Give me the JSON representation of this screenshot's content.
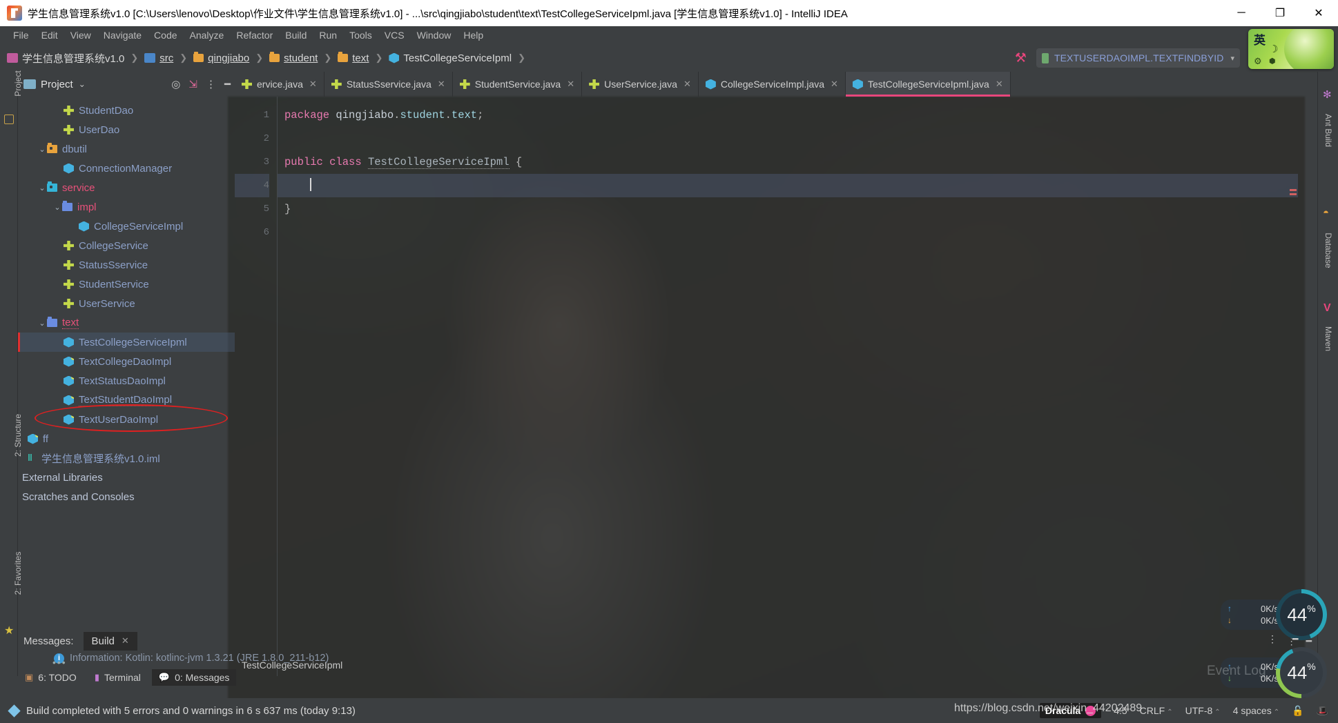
{
  "window": {
    "title": "学生信息管理系统v1.0 [C:\\Users\\lenovo\\Desktop\\作业文件\\学生信息管理系统v1.0] - ...\\src\\qingjiabo\\student\\text\\TestCollegeServiceIpml.java [学生信息管理系统v1.0] - IntelliJ IDEA",
    "minimize": "─",
    "maximize": "❐",
    "close": "✕",
    "app_icon": "intellij-idea-icon"
  },
  "menubar": {
    "items": [
      {
        "label": "File"
      },
      {
        "label": "Edit"
      },
      {
        "label": "View"
      },
      {
        "label": "Navigate"
      },
      {
        "label": "Code"
      },
      {
        "label": "Analyze"
      },
      {
        "label": "Refactor"
      },
      {
        "label": "Build"
      },
      {
        "label": "Run"
      },
      {
        "label": "Tools"
      },
      {
        "label": "VCS"
      },
      {
        "label": "Window"
      },
      {
        "label": "Help"
      }
    ]
  },
  "breadcrumb": {
    "items": [
      {
        "label": "学生信息管理系统v1.0",
        "icon": "module-icon"
      },
      {
        "label": "src",
        "icon": "source-root-icon"
      },
      {
        "label": "qingjiabo",
        "icon": "package-icon"
      },
      {
        "label": "student",
        "icon": "package-icon"
      },
      {
        "label": "text",
        "icon": "package-icon"
      },
      {
        "label": "TestCollegeServiceIpml",
        "icon": "java-class-icon"
      }
    ],
    "trailing_sep": "❯"
  },
  "toolbar": {
    "build_icon": "hammer-icon",
    "run_config": {
      "label": "TEXTUSERDAOIMPL.TEXTFINDBYID",
      "icon": "test-tube-icon",
      "dropdown": "▾"
    },
    "run_button": "▶",
    "debug_button": "debug-bug-icon",
    "run_with_coverage": "coverage-icon",
    "profile_button": "profiler-icon"
  },
  "ime_badge": {
    "mode": "英",
    "moon": "☽",
    "gear": "⚙",
    "dot": "⬢"
  },
  "project_pane": {
    "title": "Project",
    "dropdown": "⌄",
    "tools": [
      "target-icon",
      "collapse-all-icon",
      "options-icon",
      "hide-icon"
    ],
    "tree": [
      {
        "label": "StudentDao",
        "icon": "interface-icon",
        "indent": 3,
        "caret": "",
        "color": "blue"
      },
      {
        "label": "UserDao",
        "icon": "interface-icon",
        "indent": 3,
        "caret": "",
        "color": "blue"
      },
      {
        "label": "dbutil",
        "icon": "package-icon",
        "indent": 2,
        "caret": "⌄",
        "color": "blue"
      },
      {
        "label": "ConnectionManager",
        "icon": "java-class-icon",
        "indent": 3,
        "caret": "",
        "color": "blue"
      },
      {
        "label": "service",
        "icon": "package-test-icon",
        "indent": 2,
        "caret": "⌄",
        "color": "red"
      },
      {
        "label": "impl",
        "icon": "package-blue-icon",
        "indent": 3,
        "caret": "⌄",
        "color": "red"
      },
      {
        "label": "CollegeServiceImpl",
        "icon": "java-class-icon",
        "indent": 4,
        "caret": "",
        "color": "blue"
      },
      {
        "label": "CollegeService",
        "icon": "interface-icon",
        "indent": 3,
        "caret": "",
        "color": "blue"
      },
      {
        "label": "StatusSservice",
        "icon": "interface-icon",
        "indent": 3,
        "caret": "",
        "color": "blue"
      },
      {
        "label": "StudentService",
        "icon": "interface-icon",
        "indent": 3,
        "caret": "",
        "color": "blue"
      },
      {
        "label": "UserService",
        "icon": "interface-icon",
        "indent": 3,
        "caret": "",
        "color": "blue"
      },
      {
        "label": "text",
        "icon": "package-blue-icon",
        "indent": 2,
        "caret": "⌄",
        "color": "red"
      },
      {
        "label": "TestCollegeServiceIpml",
        "icon": "java-class-icon",
        "indent": 3,
        "caret": "",
        "color": "blue",
        "selected": true
      },
      {
        "label": "TextCollegeDaoImpl",
        "icon": "java-test-class-icon",
        "indent": 3,
        "caret": "",
        "color": "blue"
      },
      {
        "label": "TextStatusDaoImpl",
        "icon": "java-test-class-icon",
        "indent": 3,
        "caret": "",
        "color": "blue"
      },
      {
        "label": "TextStudentDaoImpl",
        "icon": "java-test-class-icon",
        "indent": 3,
        "caret": "",
        "color": "blue"
      },
      {
        "label": "TextUserDaoImpl",
        "icon": "java-test-class-icon",
        "indent": 3,
        "caret": "",
        "color": "blue"
      },
      {
        "label": "ff",
        "icon": "java-test-class-icon",
        "indent": 1,
        "caret": "",
        "color": "blue"
      },
      {
        "label": "学生信息管理系统v1.0.iml",
        "icon": "iml-icon",
        "indent": 1,
        "caret": "",
        "color": "blue"
      },
      {
        "label": "External Libraries",
        "icon": "",
        "indent": 0,
        "caret": "",
        "color": "plain"
      },
      {
        "label": "Scratches and Consoles",
        "icon": "",
        "indent": 0,
        "caret": "",
        "color": "plain"
      }
    ]
  },
  "left_strip": {
    "items": [
      {
        "label": "Project",
        "icon": "project-icon"
      },
      {
        "label": "2: Structure",
        "icon": "structure-icon"
      },
      {
        "label": "2: Favorites",
        "icon": "favorites-star-icon"
      }
    ]
  },
  "right_strip": {
    "items": [
      {
        "label": "Ant Build",
        "icon": "ant-icon"
      },
      {
        "label": "Database",
        "icon": "database-icon"
      },
      {
        "label": "Maven",
        "icon": "maven-icon"
      }
    ]
  },
  "editor": {
    "tabs": [
      {
        "label": "ervice.java",
        "icon": "interface-icon",
        "active": false,
        "truncated": true
      },
      {
        "label": "StatusSservice.java",
        "icon": "interface-icon",
        "active": false
      },
      {
        "label": "StudentService.java",
        "icon": "interface-icon",
        "active": false
      },
      {
        "label": "UserService.java",
        "icon": "interface-icon",
        "active": false
      },
      {
        "label": "CollegeServiceImpl.java",
        "icon": "java-class-icon",
        "active": false
      },
      {
        "label": "TestCollegeServiceIpml.java",
        "icon": "java-class-icon",
        "active": true
      }
    ],
    "close_glyph": "✕",
    "line_numbers": [
      "1",
      "2",
      "3",
      "4",
      "5",
      "6"
    ],
    "lines": [
      {
        "n": 1,
        "tokens": [
          {
            "t": "package ",
            "c": "kw"
          },
          {
            "t": "qingjiabo",
            "c": "id"
          },
          {
            "t": ".",
            "c": "punct"
          },
          {
            "t": "student",
            "c": "pl"
          },
          {
            "t": ".",
            "c": "punct"
          },
          {
            "t": "text",
            "c": "pl"
          },
          {
            "t": ";",
            "c": "punct"
          }
        ]
      },
      {
        "n": 2,
        "tokens": []
      },
      {
        "n": 3,
        "tokens": [
          {
            "t": "public ",
            "c": "kw"
          },
          {
            "t": "class ",
            "c": "kw"
          },
          {
            "t": "TestCollegeServiceIpml",
            "c": "warnu"
          },
          {
            "t": " {",
            "c": "punct"
          }
        ]
      },
      {
        "n": 4,
        "tokens": [],
        "current": true
      },
      {
        "n": 5,
        "tokens": [
          {
            "t": "}",
            "c": "punct"
          }
        ]
      },
      {
        "n": 6,
        "tokens": []
      }
    ],
    "status_breadcrumb": "TestCollegeServiceIpml"
  },
  "messages_panel": {
    "label": "Messages:",
    "tab": "Build",
    "close": "✕",
    "dots": "•••",
    "entry": "Information: Kotlin: kotlinc-jvm 1.3.21 (JRE 1.8.0_211-b12)",
    "info_glyph": "i",
    "tools": [
      "options-icon",
      "hide-icon"
    ]
  },
  "bottom_tabs": [
    {
      "label": "6: TODO",
      "icon": "todo-icon",
      "active": false
    },
    {
      "label": "Terminal",
      "icon": "terminal-icon",
      "active": false
    },
    {
      "label": "0: Messages",
      "icon": "messages-icon",
      "active": true
    }
  ],
  "status_bar": {
    "message": "Build completed with 5 errors and 0 warnings in 6 s 637 ms (today 9:13)",
    "theme": "Dracula",
    "caret_position": "4:5",
    "line_separator": "CRLF",
    "encoding": "UTF-8",
    "indent": "4 spaces",
    "lock_icon": "unlock-icon",
    "inspector_icon": "hector-icon",
    "stepper_glyph": "⌃"
  },
  "widgets": [
    {
      "upload": "0K/s",
      "download": "0K/s",
      "up_glyph": "↑",
      "down_glyph": "↓",
      "percent": "44",
      "percent_unit": "%"
    },
    {
      "upload": "0K/s",
      "download": "0K/s",
      "up_glyph": "↑",
      "down_glyph": "↓",
      "percent": "44",
      "percent_unit": "%"
    }
  ],
  "overlays": {
    "watermark": "https://blog.csdn.net/weixin_44202489",
    "event_log": "Event Log",
    "gauge_tools": [
      "options-icon",
      "hide-icon"
    ]
  },
  "colors": {
    "accent_pink": "#e8467c",
    "selection": "#4b5e78",
    "annotation_red": "#e02020",
    "background": "#3c3f41",
    "editor_bg": "#2b2b2b"
  }
}
